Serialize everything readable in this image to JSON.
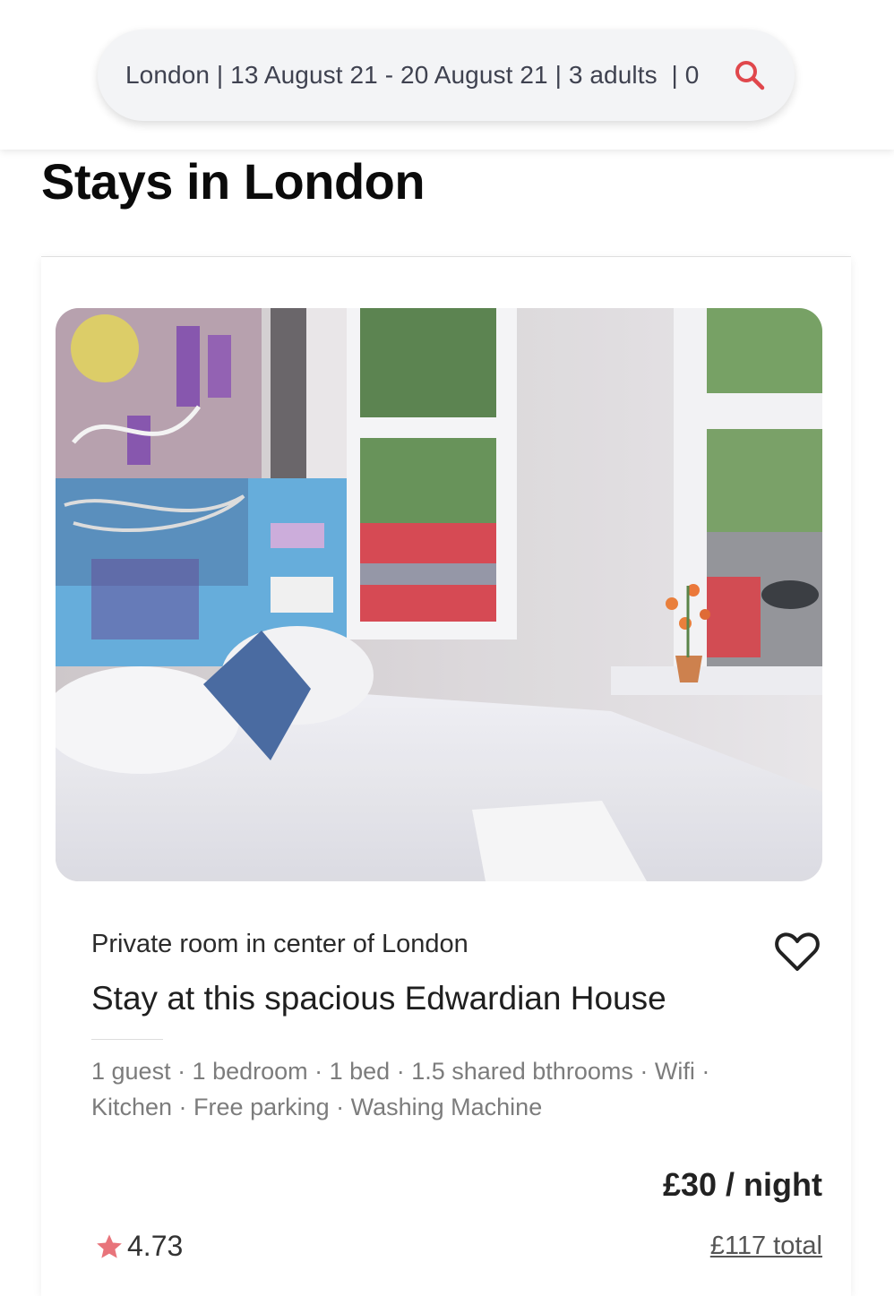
{
  "search": {
    "summary": "London | 13 August 21 - 20 August 21 | 3 adults  | 0",
    "icon": "search-icon",
    "icon_color": "#e0474c"
  },
  "page": {
    "title": "Stays in London"
  },
  "listing": {
    "subtitle": "Private room in center of London",
    "title": "Stay at this spacious Edwardian House",
    "amenities": "1 guest · 1 bedroom · 1 bed · 1.5 shared bthrooms · Wifi · Kitchen · Free parking · Washing Machine",
    "price": "£30 / night",
    "rating": "4.73",
    "total": "£117 total",
    "star_color": "#e8747b",
    "favorite_icon": "heart-icon"
  }
}
